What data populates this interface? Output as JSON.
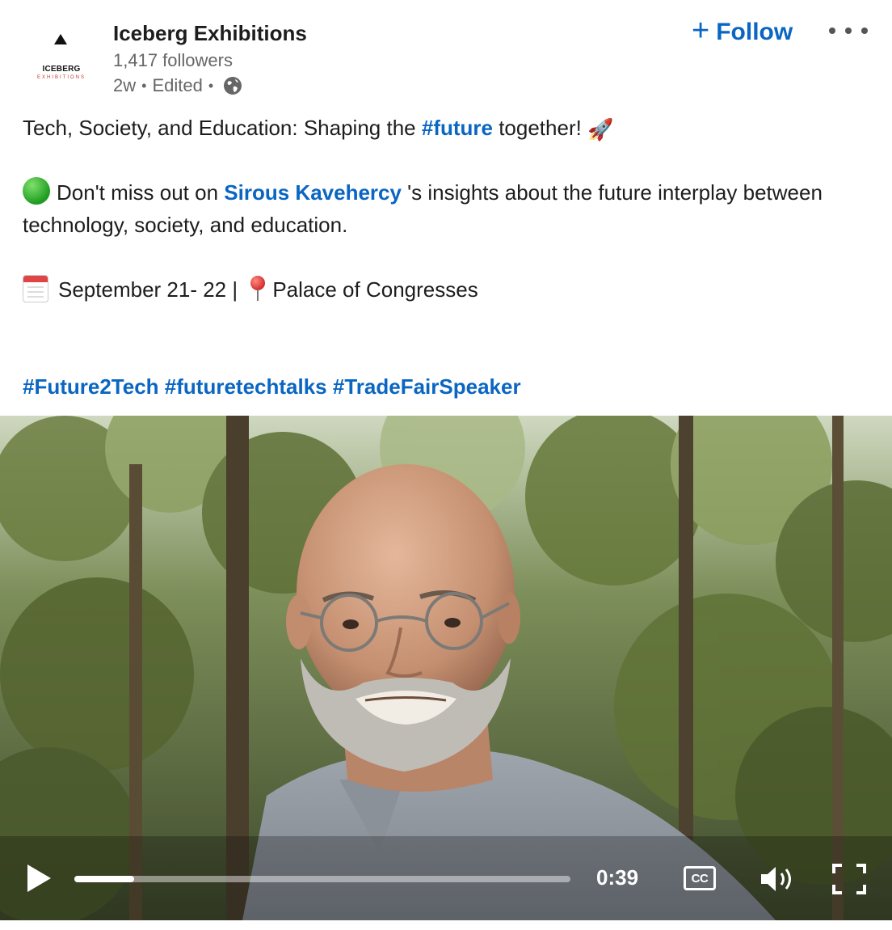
{
  "author": {
    "name": "Iceberg Exhibitions",
    "followers": "1,417 followers",
    "age": "2w",
    "edited": "Edited",
    "logo_wordmark": "ICEBERG",
    "logo_sub": "EXHIBITIONS"
  },
  "actions": {
    "follow_label": "Follow",
    "more_icon": "more-horizontal-icon"
  },
  "post": {
    "line1_before": "Tech, Society, and Education: Shaping the ",
    "line1_hashtag": "#future",
    "line1_after": " together! ",
    "line1_emoji": "🚀",
    "line2_before": "Don't miss out on ",
    "line2_mention": "Sirous Kavehercy",
    "line2_after": " 's insights about the future interplay between technology, society, and education.",
    "line3_date": "September 21- 22 | ",
    "line3_place": "Palace of Congresses",
    "hashtags": [
      "#Future2Tech",
      "#futuretechtalks",
      "#TradeFairSpeaker"
    ]
  },
  "video": {
    "duration": "0:39",
    "progress_fraction": 0.12,
    "cc_label": "CC"
  },
  "colors": {
    "link": "#0a66c2",
    "text": "#1d1d1d",
    "secondary": "#666666"
  }
}
